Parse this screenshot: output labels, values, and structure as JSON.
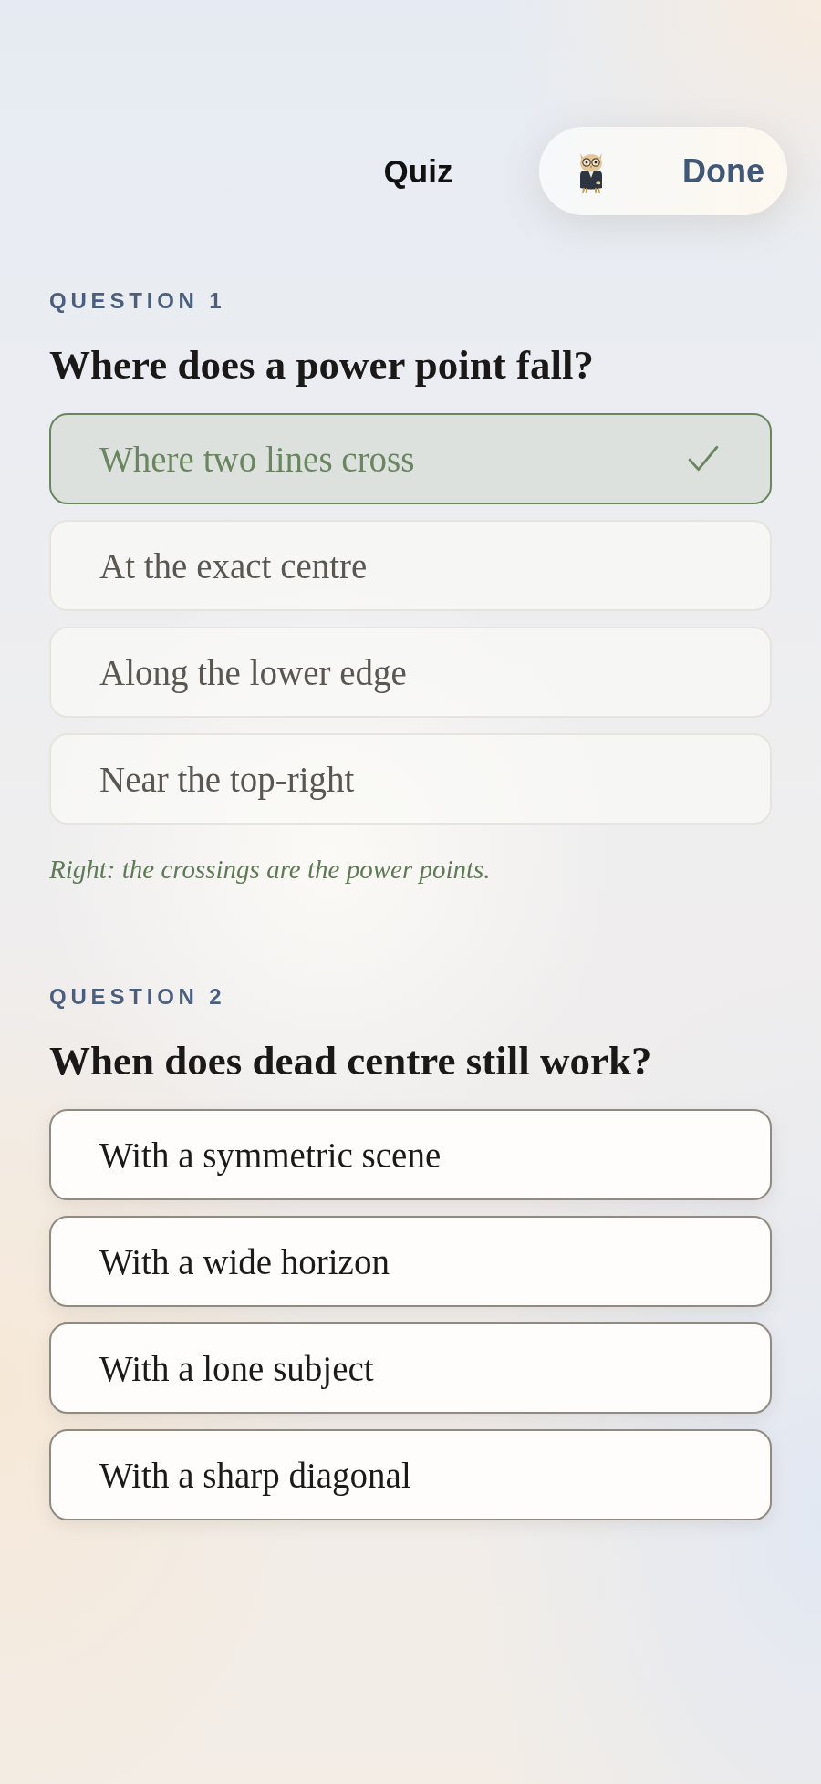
{
  "header": {
    "title": "Quiz",
    "done_button": "Done"
  },
  "questions": [
    {
      "label": "QUESTION 1",
      "prompt": "Where does a power point fall?",
      "options": [
        {
          "text": "Where two lines cross",
          "selected": true
        },
        {
          "text": "At the exact centre",
          "selected": false
        },
        {
          "text": "Along the lower edge",
          "selected": false
        },
        {
          "text": "Near the top-right",
          "selected": false
        }
      ],
      "feedback": "Right: the crossings are the power points."
    },
    {
      "label": "QUESTION 2",
      "prompt": "When does dead centre still work?",
      "options": [
        {
          "text": "With a symmetric scene",
          "selected": false
        },
        {
          "text": "With a wide horizon",
          "selected": false
        },
        {
          "text": "With a lone subject",
          "selected": false
        },
        {
          "text": "With a sharp diagonal",
          "selected": false
        }
      ]
    }
  ]
}
